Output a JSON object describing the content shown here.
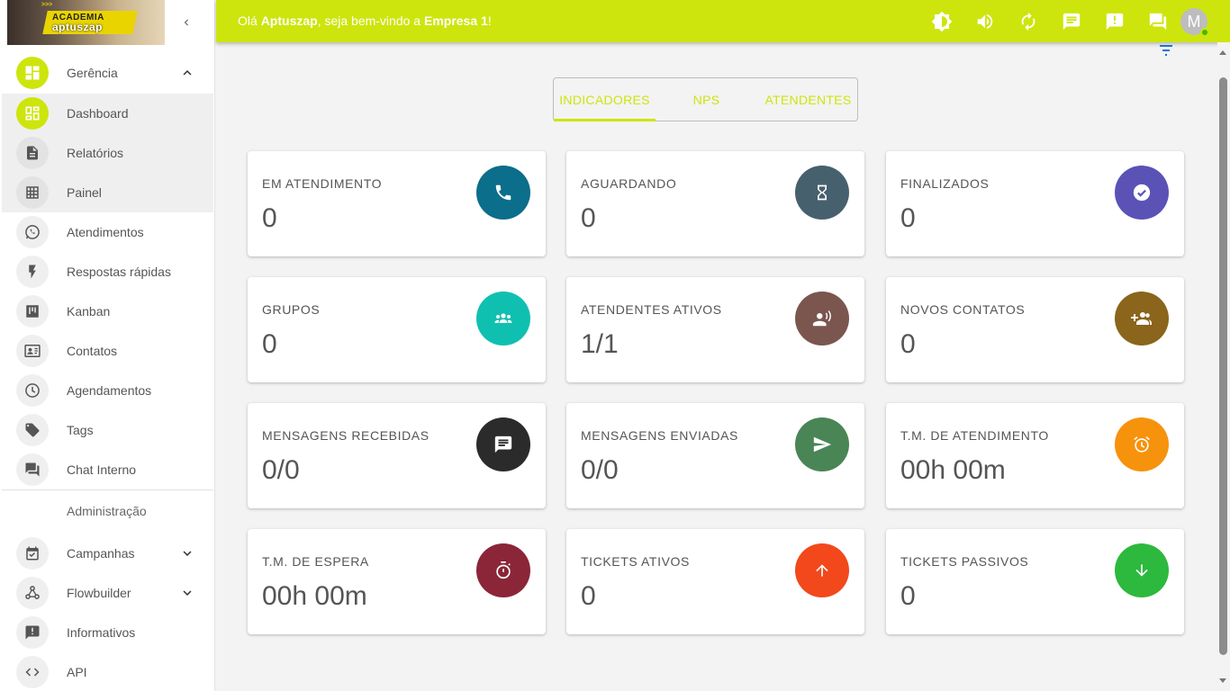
{
  "header": {
    "greeting_prefix": "Olá ",
    "user": "Aptuszap",
    "greeting_middle": ", seja bem-vindo a ",
    "company": "Empresa 1",
    "greeting_suffix": "!",
    "avatar_initial": "M"
  },
  "logo": {
    "line1": "ACADEMIA",
    "line2": "aptuszap",
    "arrows": ">>>"
  },
  "sidebar": {
    "items": [
      {
        "label": "Gerência",
        "icon": "dashboard-icon"
      },
      {
        "label": "Dashboard",
        "icon": "grid-icon"
      },
      {
        "label": "Relatórios",
        "icon": "document-icon"
      },
      {
        "label": "Painel",
        "icon": "table-icon"
      },
      {
        "label": "Atendimentos",
        "icon": "whatsapp-icon"
      },
      {
        "label": "Respostas rápidas",
        "icon": "bolt-icon"
      },
      {
        "label": "Kanban",
        "icon": "kanban-icon"
      },
      {
        "label": "Contatos",
        "icon": "contacts-icon"
      },
      {
        "label": "Agendamentos",
        "icon": "clock-icon"
      },
      {
        "label": "Tags",
        "icon": "tag-icon"
      },
      {
        "label": "Chat Interno",
        "icon": "chat-icon"
      }
    ],
    "section_label": "Administração",
    "admin_items": [
      {
        "label": "Campanhas",
        "icon": "calendar-check-icon"
      },
      {
        "label": "Flowbuilder",
        "icon": "webhook-icon"
      },
      {
        "label": "Informativos",
        "icon": "announcement-icon"
      },
      {
        "label": "API",
        "icon": "code-icon"
      }
    ]
  },
  "tabs": [
    {
      "label": "INDICADORES",
      "active": true
    },
    {
      "label": "NPS",
      "active": false
    },
    {
      "label": "ATENDENTES",
      "active": false
    }
  ],
  "cards": [
    {
      "title": "EM ATENDIMENTO",
      "value": "0",
      "icon": "phone-icon",
      "color": "#0b6e8a"
    },
    {
      "title": "AGUARDANDO",
      "value": "0",
      "icon": "hourglass-icon",
      "color": "#47606e"
    },
    {
      "title": "FINALIZADOS",
      "value": "0",
      "icon": "check-circle-icon",
      "color": "#5b52b6"
    },
    {
      "title": "GRUPOS",
      "value": "0",
      "icon": "groups-icon",
      "color": "#0fc0b0"
    },
    {
      "title": "ATENDENTES ATIVOS",
      "value": "1/1",
      "icon": "record-voice-icon",
      "color": "#7b564f"
    },
    {
      "title": "NOVOS CONTATOS",
      "value": "0",
      "icon": "group-add-icon",
      "color": "#8a651b"
    },
    {
      "title": "MENSAGENS RECEBIDAS",
      "value": "0/0",
      "icon": "message-icon",
      "color": "#2b2b2b"
    },
    {
      "title": "MENSAGENS ENVIADAS",
      "value": "0/0",
      "icon": "send-icon",
      "color": "#4a8556"
    },
    {
      "title": "T.M. DE ATENDIMENTO",
      "value": "00h 00m",
      "icon": "alarm-icon",
      "color": "#f7920c"
    },
    {
      "title": "T.M. DE ESPERA",
      "value": "00h 00m",
      "icon": "timer-icon",
      "color": "#8a2638"
    },
    {
      "title": "TICKETS ATIVOS",
      "value": "0",
      "icon": "arrow-up-icon",
      "color": "#f2481b"
    },
    {
      "title": "TICKETS PASSIVOS",
      "value": "0",
      "icon": "arrow-down-icon",
      "color": "#2cb93d"
    }
  ],
  "colors": {
    "accent": "#cde50c"
  }
}
